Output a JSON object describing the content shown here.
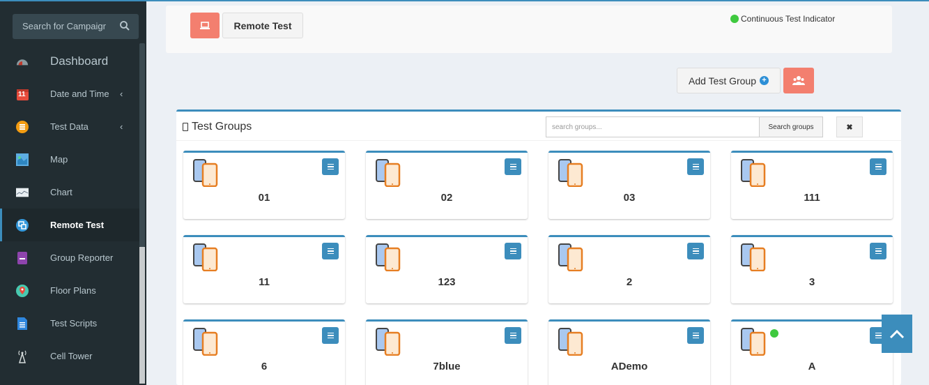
{
  "sidebar": {
    "search_placeholder": "Search for Campaigr",
    "items": [
      {
        "label": "Dashboard",
        "icon": "dashboard-gauge-icon",
        "chevron": ""
      },
      {
        "label": "Date and Time",
        "icon": "calendar-icon",
        "chevron": "‹",
        "calendar_day": "11"
      },
      {
        "label": "Test Data",
        "icon": "database-icon",
        "chevron": "‹"
      },
      {
        "label": "Map",
        "icon": "map-icon",
        "chevron": ""
      },
      {
        "label": "Chart",
        "icon": "chart-icon",
        "chevron": ""
      },
      {
        "label": "Remote Test",
        "icon": "remote-test-icon",
        "chevron": "",
        "active": true
      },
      {
        "label": "Group Reporter",
        "icon": "report-icon",
        "chevron": ""
      },
      {
        "label": "Floor Plans",
        "icon": "location-pin-icon",
        "chevron": ""
      },
      {
        "label": "Test Scripts",
        "icon": "document-icon",
        "chevron": ""
      },
      {
        "label": "Cell Tower",
        "icon": "cell-tower-icon",
        "chevron": ""
      }
    ]
  },
  "toolbar": {
    "remote_test_label": "Remote Test",
    "indicator_label": "Continuous Test Indicator",
    "add_group_label": "Add Test Group"
  },
  "groups_box": {
    "title": "Test Groups",
    "search_placeholder": "search groups...",
    "search_button": "Search groups",
    "clear_button": "✖"
  },
  "groups": [
    {
      "name": "01",
      "continuous": false
    },
    {
      "name": "02",
      "continuous": false
    },
    {
      "name": "03",
      "continuous": false
    },
    {
      "name": "111",
      "continuous": false
    },
    {
      "name": "11",
      "continuous": false
    },
    {
      "name": "123",
      "continuous": false
    },
    {
      "name": "2",
      "continuous": false
    },
    {
      "name": "3",
      "continuous": false
    },
    {
      "name": "6",
      "continuous": false
    },
    {
      "name": "7blue",
      "continuous": false
    },
    {
      "name": "ADemo",
      "continuous": false
    },
    {
      "name": "A",
      "continuous": true
    }
  ],
  "colors": {
    "accent": "#3c8dbc",
    "salmon": "#f37f6f",
    "indicator_green": "#3fc93f",
    "sidebar_bg": "#222d32"
  }
}
